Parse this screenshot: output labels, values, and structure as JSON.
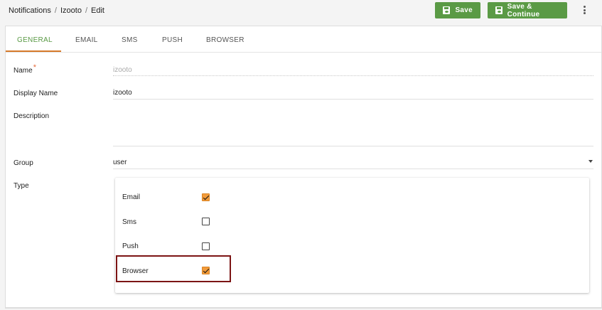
{
  "breadcrumb": {
    "root": "Notifications",
    "sep": "/",
    "item": "Izooto",
    "current": "Edit"
  },
  "toolbar": {
    "save_label": "Save",
    "save_continue_label": "Save & Continue"
  },
  "tabs": [
    {
      "label": "GENERAL",
      "active": true
    },
    {
      "label": "EMAIL",
      "active": false
    },
    {
      "label": "SMS",
      "active": false
    },
    {
      "label": "PUSH",
      "active": false
    },
    {
      "label": "BROWSER",
      "active": false
    }
  ],
  "form": {
    "name": {
      "label": "Name",
      "required_mark": "*",
      "placeholder": "izooto"
    },
    "display_name": {
      "label": "Display Name",
      "value": "izooto"
    },
    "description": {
      "label": "Description",
      "value": ""
    },
    "group": {
      "label": "Group",
      "value": "user"
    },
    "type": {
      "label": "Type",
      "options": [
        {
          "label": "Email",
          "checked": true
        },
        {
          "label": "Sms",
          "checked": false
        },
        {
          "label": "Push",
          "checked": false
        },
        {
          "label": "Browser",
          "checked": true
        }
      ]
    }
  },
  "colors": {
    "accent": "#5a9a45",
    "tab_underline": "#d67a2a",
    "checkbox_checked": "#f29b3a",
    "highlight": "#7c1414"
  },
  "icons": {
    "save": "floppy-disk-icon",
    "menu": "more-vert-icon",
    "dropdown": "caret-down-icon"
  }
}
